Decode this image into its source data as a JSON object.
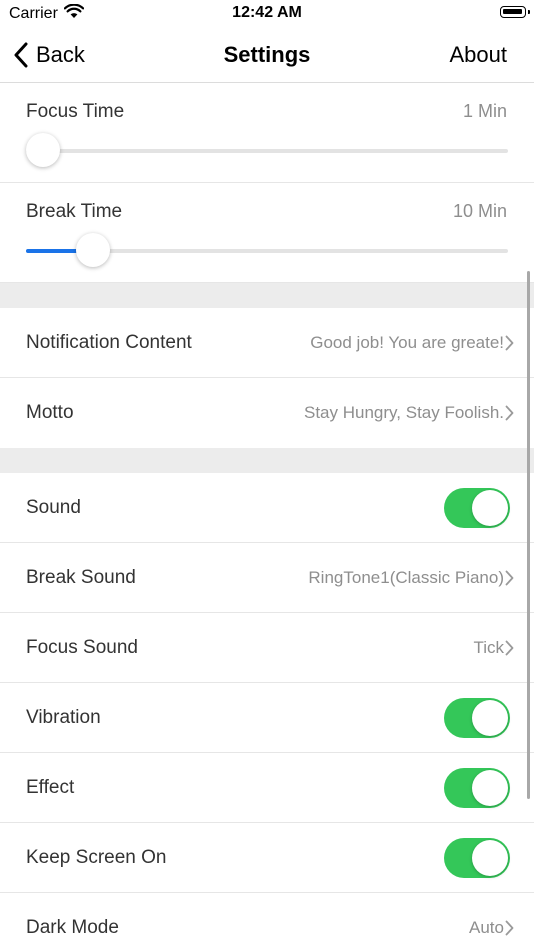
{
  "status_bar": {
    "carrier": "Carrier",
    "time": "12:42 AM"
  },
  "nav": {
    "back_label": "Back",
    "title": "Settings",
    "about_label": "About"
  },
  "sliders": [
    {
      "label": "Focus Time",
      "value": "1 Min",
      "fraction": 0.0
    },
    {
      "label": "Break Time",
      "value": "10 Min",
      "fraction": 0.14
    }
  ],
  "text_rows": [
    {
      "label": "Notification Content",
      "detail": "Good job! You are greate!"
    },
    {
      "label": "Motto",
      "detail": "Stay Hungry, Stay Foolish."
    }
  ],
  "sound_rows": [
    {
      "label": "Sound",
      "toggle": true
    },
    {
      "label": "Break Sound",
      "detail": "RingTone1(Classic Piano)"
    },
    {
      "label": "Focus Sound",
      "detail": "Tick"
    },
    {
      "label": "Vibration",
      "toggle": true
    },
    {
      "label": "Effect",
      "toggle": true
    },
    {
      "label": "Keep Screen On",
      "toggle": true
    },
    {
      "label": "Dark Mode",
      "detail": "Auto"
    }
  ],
  "colors": {
    "accent": "#1a73e8",
    "toggle_on": "#34c759",
    "section_gap": "#ececec"
  }
}
